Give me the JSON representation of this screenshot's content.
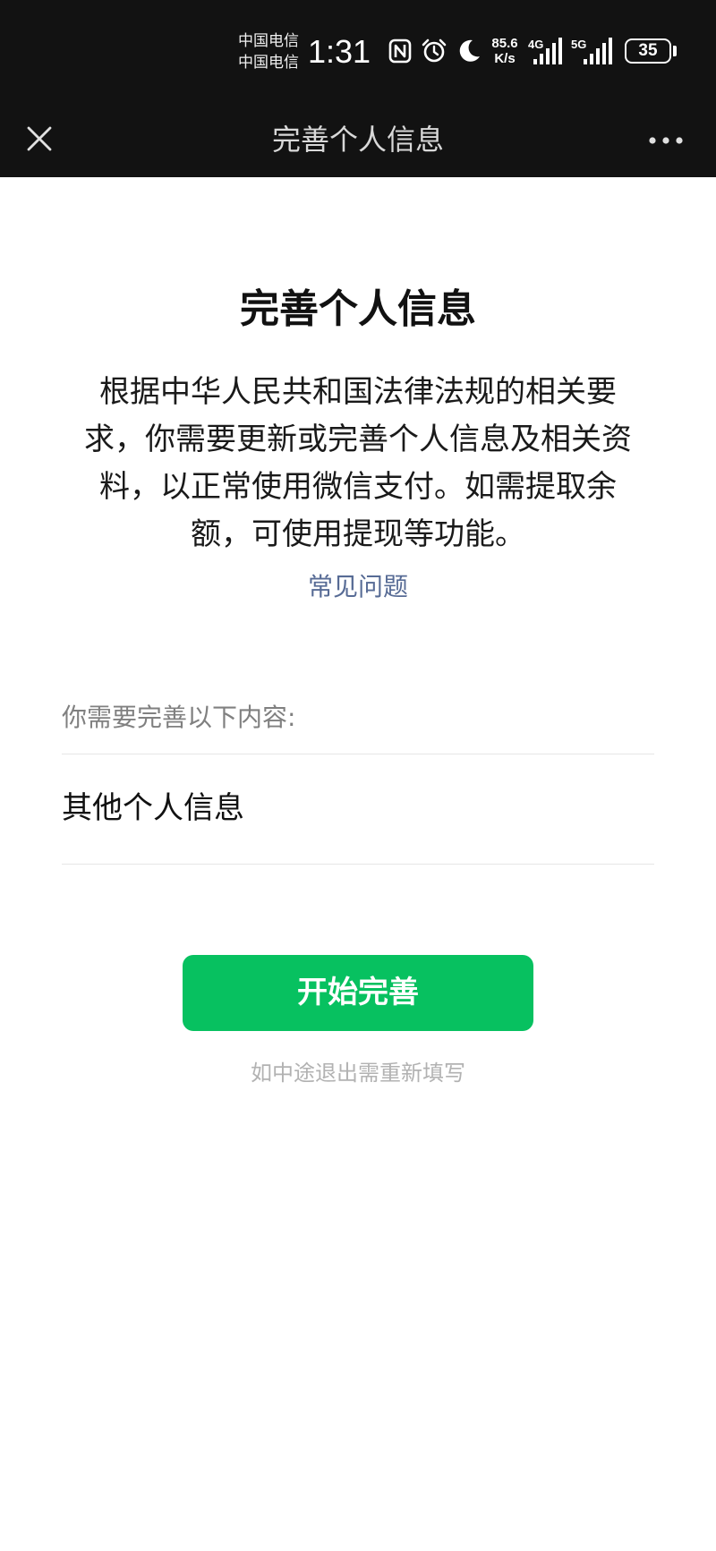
{
  "status_bar": {
    "carrier_1": "中国电信",
    "carrier_2": "中国电信",
    "time": "1:31",
    "net_speed_value": "85.6",
    "net_speed_unit": "K/s",
    "signal_1_label": "4G",
    "signal_2_label": "5G",
    "battery_level": "35"
  },
  "nav_bar": {
    "title": "完善个人信息",
    "close_icon": "close-icon",
    "more_icon": "more-dots-icon"
  },
  "main": {
    "heading": "完善个人信息",
    "description_lines": [
      "根据中华人民共和国法律法规的相关要",
      "求，你需要更新或完善个人信息及相关资",
      "料，以正常使用微信支付。如需提取余",
      "额，可使用提现等功能。"
    ],
    "faq_link": "常见问题",
    "section_label": "你需要完善以下内容:",
    "items": [
      "其他个人信息"
    ],
    "start_button": "开始完善",
    "exit_note": "如中途退出需重新填写"
  },
  "colors": {
    "status_bg": "#121212",
    "primary_green": "#07c160",
    "link_blue": "#576b95",
    "muted_text": "#808080",
    "hint_text": "#b2b2b2"
  }
}
